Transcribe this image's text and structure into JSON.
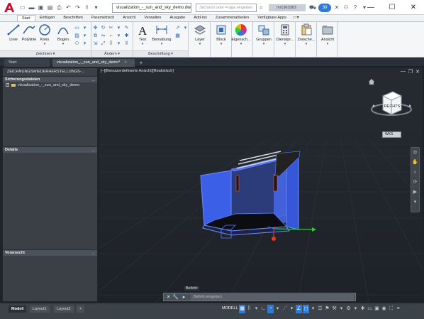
{
  "title_bar": {
    "document_tab": "visualization_-_sun_and_sky_demo.dwg",
    "search_placeholder": "Stichwort oder Frage eingeben",
    "user_name": "mr1963363",
    "badge_count": "30",
    "help_label": "?"
  },
  "ribbon_tabs": [
    "Start",
    "Einfügen",
    "Beschriften",
    "Parametrisch",
    "Ansicht",
    "Verwalten",
    "Ausgabe",
    "Add-ins",
    "Zusammenarbeiten",
    "Verfügbare Apps"
  ],
  "ribbon": {
    "zeichnen": {
      "panel_label": "Zeichnen ▾",
      "buttons": [
        "Linie",
        "Polylinie",
        "Kreis",
        "Bogen"
      ]
    },
    "aendern": {
      "panel_label": "Ändern ▾"
    },
    "beschriftung": {
      "panel_label": "Beschriftung ▾",
      "buttons": [
        "Text",
        "Bemaßung"
      ]
    },
    "big_buttons": [
      "Layer",
      "Block",
      "Eigensch...",
      "Gruppen",
      "Dienstpr...",
      "Zwische...",
      "Ansicht"
    ]
  },
  "file_tabs": {
    "start": "Start",
    "drawing": "visualization_-_sun_and_sky_demo*",
    "close": "×",
    "add": "+"
  },
  "palette": {
    "title": "ZEICHNUNGSWIEDERHERSTELLUNGS-...",
    "sections": {
      "backups": {
        "label": "Sicherungsdateien",
        "items": [
          "visualization_-_sun_and_sky_demo"
        ]
      },
      "details": {
        "label": "Details"
      },
      "preview": {
        "label": "Voransicht"
      }
    },
    "minimize": "_"
  },
  "viewport": {
    "label": "[−][Benutzerdefinierte Ansicht][Realistisch]",
    "viewcube_face": "RECHTS",
    "wcs_label": "WKS",
    "command_label": "Befehl:",
    "command_placeholder": "Befehl eingeben"
  },
  "status_bar": {
    "layout_tabs": [
      "Modell",
      "Layout1",
      "Layout2"
    ],
    "add": "+",
    "model_label": "MODELL"
  },
  "colors": {
    "app_red": "#c8102e",
    "accent_blue": "#2e7bd6",
    "model_wire": "#3f6fff",
    "axis_green": "#2fcf3a",
    "axis_red": "#e23a2a"
  }
}
